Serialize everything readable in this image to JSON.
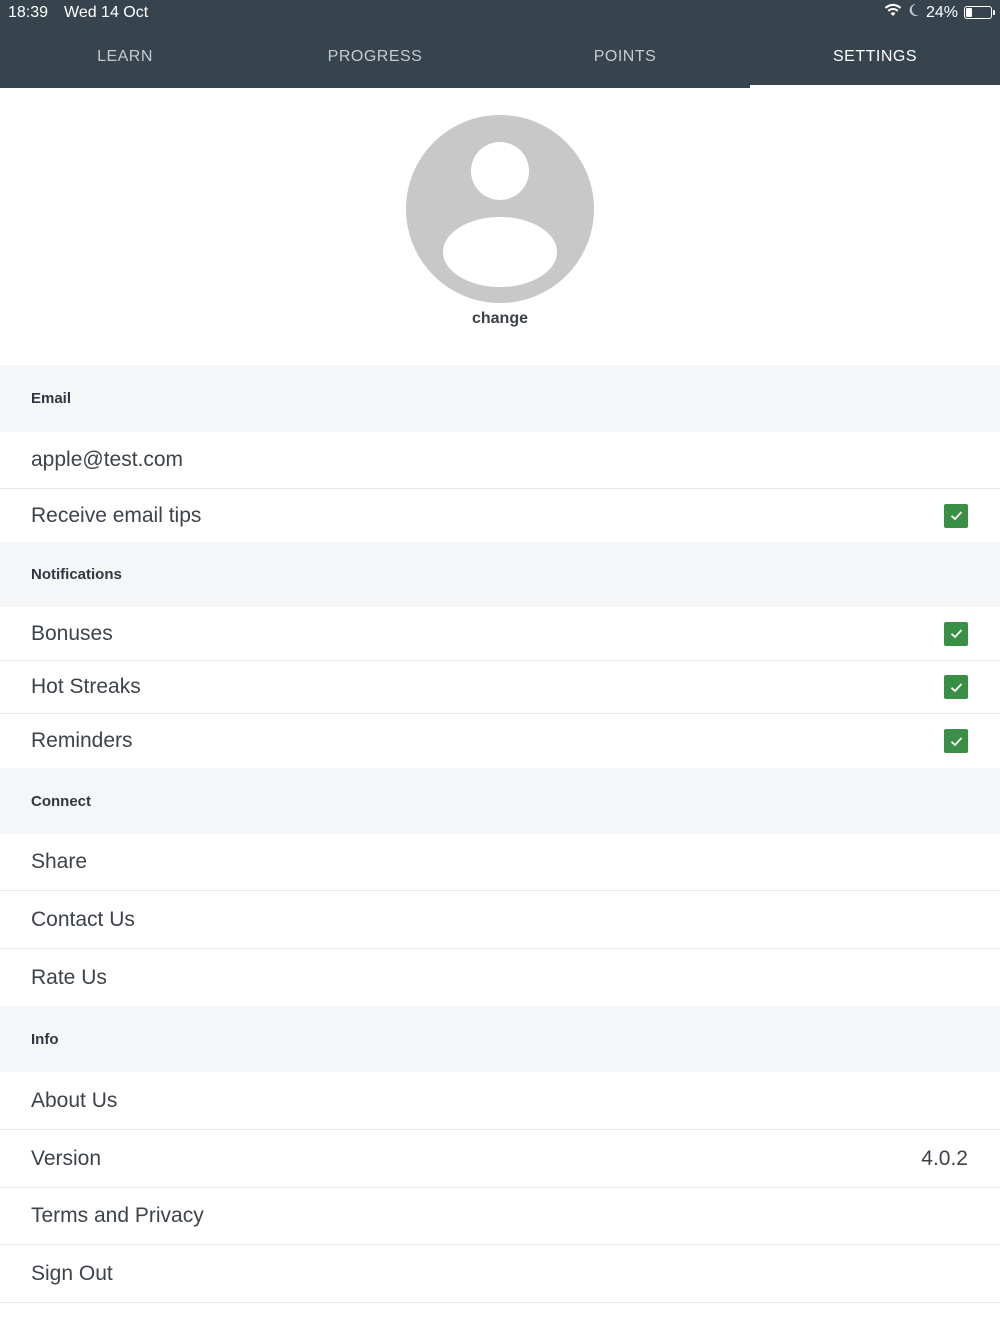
{
  "status": {
    "time": "18:39",
    "date": "Wed 14 Oct",
    "battery": "24%",
    "battery_level": 0.24
  },
  "tabs": [
    {
      "label": "LEARN"
    },
    {
      "label": "PROGRESS"
    },
    {
      "label": "POINTS"
    },
    {
      "label": "SETTINGS",
      "active": true
    }
  ],
  "profile": {
    "change_label": "change"
  },
  "sections": {
    "email": {
      "header": "Email",
      "address": "apple@test.com",
      "tips_label": "Receive email tips",
      "tips_checked": true
    },
    "notifications": {
      "header": "Notifications",
      "items": [
        {
          "label": "Bonuses",
          "checked": true
        },
        {
          "label": "Hot Streaks",
          "checked": true
        },
        {
          "label": "Reminders",
          "checked": true
        }
      ]
    },
    "connect": {
      "header": "Connect",
      "items": [
        {
          "label": "Share"
        },
        {
          "label": "Contact Us"
        },
        {
          "label": "Rate Us"
        }
      ]
    },
    "info": {
      "header": "Info",
      "about": "About Us",
      "version_label": "Version",
      "version_value": "4.0.2",
      "terms": "Terms and Privacy",
      "signout": "Sign Out"
    }
  },
  "colors": {
    "header_bg": "#37444d",
    "check_green": "#3a8f47",
    "section_bg": "#f5f6f7"
  }
}
